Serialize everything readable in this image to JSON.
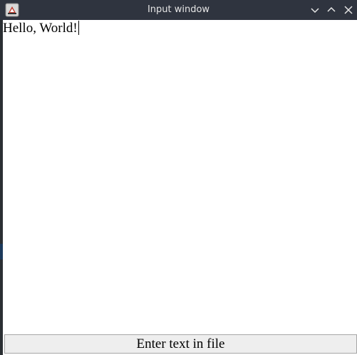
{
  "window": {
    "title": "Input window",
    "app_icon": "java-app-icon",
    "controls": {
      "minimize_icon": "chevron-down-icon",
      "maximize_icon": "chevron-up-icon",
      "close_icon": "close-icon"
    }
  },
  "editor": {
    "text": "Hello, World!"
  },
  "action": {
    "enter_label": "Enter text in file"
  },
  "colors": {
    "titlebar": "#2f343f",
    "title_text": "#e6e6e6",
    "content_bg": "#ffffff",
    "button_bg": "#eeeeee"
  }
}
